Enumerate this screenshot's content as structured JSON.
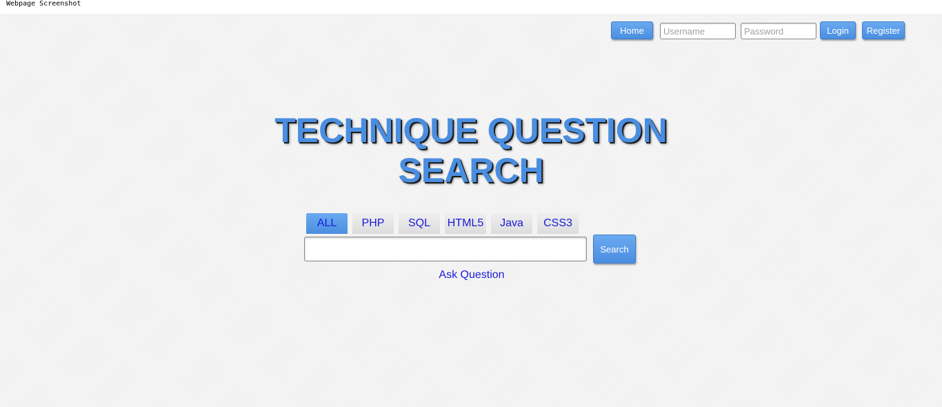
{
  "caption": "Webpage Screenshot",
  "header": {
    "home_label": "Home",
    "username_placeholder": "Username",
    "password_placeholder": "Password",
    "login_label": "Login",
    "register_label": "Register"
  },
  "main": {
    "title": "TECHNIQUE QUESTION SEARCH",
    "tabs": [
      {
        "label": "ALL",
        "active": true
      },
      {
        "label": "PHP",
        "active": false
      },
      {
        "label": "SQL",
        "active": false
      },
      {
        "label": "HTML5",
        "active": false
      },
      {
        "label": "Java",
        "active": false
      },
      {
        "label": "CSS3",
        "active": false
      }
    ],
    "search_value": "",
    "search_label": "Search",
    "ask_label": "Ask Question"
  },
  "colors": {
    "accent": "#4a8ee0",
    "link": "#1a1ad8",
    "background": "#f3f3f3"
  }
}
